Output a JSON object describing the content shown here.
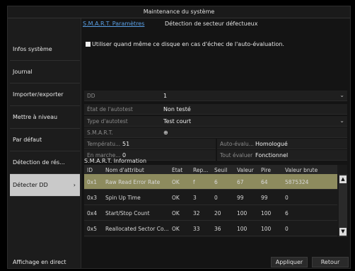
{
  "window": {
    "title": "Maintenance du système"
  },
  "sidebar": {
    "items": [
      {
        "label": "Infos système"
      },
      {
        "label": "Journal"
      },
      {
        "label": "Importer/exporter"
      },
      {
        "label": "Mettre à niveau"
      },
      {
        "label": "Par défaut"
      },
      {
        "label": "Détection de rés..."
      },
      {
        "label": "Détecter DD",
        "arrow": "›",
        "active": true
      }
    ],
    "bottom": "Affichage en direct"
  },
  "tabs": [
    {
      "label": "S.M.A.R.T. Paramètres",
      "active": true
    },
    {
      "label": "Détection de secteur défectueux",
      "active": false
    }
  ],
  "checkbox": {
    "label": "Utiliser quand même ce disque en cas d'échec de l'auto-évaluation."
  },
  "fields": {
    "dd": {
      "label": "DD",
      "value": "1"
    },
    "self_test_state": {
      "label": "État de l'autotest",
      "value": "Non testé"
    },
    "self_test_type": {
      "label": "Type d'autotest",
      "value": "Test court"
    },
    "smart": {
      "label": "S.M.A.R.T.",
      "value": "⊕"
    },
    "temperature": {
      "label": "Températu...",
      "value": "51"
    },
    "self_eval": {
      "label": "Auto-évalu...",
      "value": "Homologué"
    },
    "running": {
      "label": "En marche...",
      "value": "0"
    },
    "overall_eval": {
      "label": "Tout évaluer",
      "value": "Fonctionnel"
    }
  },
  "smart_info": {
    "title": "S.M.A.R.T. Information",
    "columns": [
      "ID",
      "Nom d'attribut",
      "État",
      "Rep...",
      "Seuil",
      "Valeur",
      "Pire",
      "Valeur brute"
    ],
    "rows": [
      [
        "0x1",
        "Raw Read Error Rate",
        "OK",
        "f",
        "6",
        "67",
        "64",
        "5875324"
      ],
      [
        "0x3",
        "Spin Up Time",
        "OK",
        "3",
        "0",
        "99",
        "99",
        "0"
      ],
      [
        "0x4",
        "Start/Stop Count",
        "OK",
        "32",
        "20",
        "100",
        "100",
        "6"
      ],
      [
        "0x5",
        "Reallocated Sector Co...",
        "OK",
        "33",
        "36",
        "100",
        "100",
        "0"
      ]
    ]
  },
  "buttons": {
    "apply": "Appliquer",
    "back": "Retour"
  },
  "colors": {
    "tab_active": "#5aa0e6",
    "row_selected": "#8d8b5e",
    "sidebar_active": "#c9c9c9"
  }
}
